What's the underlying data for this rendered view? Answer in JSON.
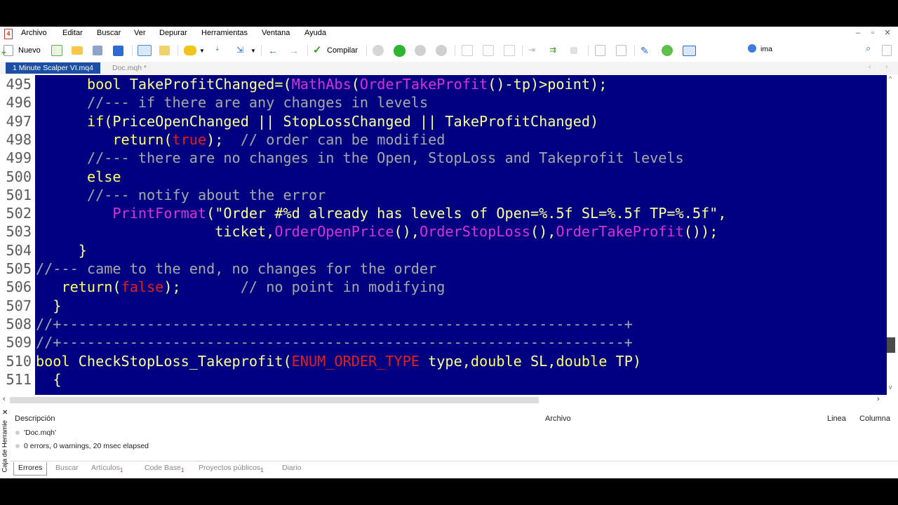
{
  "menu": [
    "Archivo",
    "Editar",
    "Buscar",
    "Ver",
    "Depurar",
    "Herramientas",
    "Ventana",
    "Ayuda"
  ],
  "app_icon": "4",
  "window_controls": [
    "–",
    "▫",
    "✕"
  ],
  "toolbar": {
    "new_label": "Nuevo",
    "compile_label": "Compilar"
  },
  "search": {
    "value": "ima"
  },
  "tabs": [
    {
      "label": "1 Minute Scalper VI.mq4"
    },
    {
      "label": "Doc.mqh *"
    }
  ],
  "code_lines": [
    {
      "num": "495",
      "indent": "      ",
      "tokens": [
        [
          "kw",
          "bool "
        ],
        [
          "id",
          "TakeProfitChanged=("
        ],
        [
          "fn",
          "MathAbs"
        ],
        [
          "id",
          "("
        ],
        [
          "fn",
          "OrderTakeProfit"
        ],
        [
          "id",
          "()-tp)>point);"
        ]
      ]
    },
    {
      "num": "496",
      "indent": "      ",
      "tokens": [
        [
          "cm",
          "//--- if there are any changes in levels"
        ]
      ]
    },
    {
      "num": "497",
      "indent": "      ",
      "tokens": [
        [
          "kw",
          "if"
        ],
        [
          "id",
          "(PriceOpenChanged || StopLossChanged || TakeProfitChanged)"
        ]
      ]
    },
    {
      "num": "498",
      "indent": "         ",
      "tokens": [
        [
          "kw",
          "return"
        ],
        [
          "id",
          "("
        ],
        [
          "red",
          "true"
        ],
        [
          "id",
          ");  "
        ],
        [
          "cm",
          "// order can be modified"
        ]
      ]
    },
    {
      "num": "499",
      "indent": "      ",
      "tokens": [
        [
          "cm",
          "//--- there are no changes in the Open, StopLoss and Takeprofit levels"
        ]
      ]
    },
    {
      "num": "500",
      "indent": "      ",
      "tokens": [
        [
          "kw",
          "else"
        ]
      ]
    },
    {
      "num": "501",
      "indent": "      ",
      "tokens": [
        [
          "cm",
          "//--- notify about the error"
        ]
      ]
    },
    {
      "num": "502",
      "indent": "         ",
      "tokens": [
        [
          "fn",
          "PrintFormat"
        ],
        [
          "st",
          "(\"Order #%d already has levels of Open=%.5f SL=%.5f TP=%.5f\","
        ]
      ]
    },
    {
      "num": "503",
      "indent": "                     ",
      "tokens": [
        [
          "id",
          "ticket,"
        ],
        [
          "fn",
          "OrderOpenPrice"
        ],
        [
          "id",
          "(),"
        ],
        [
          "fn",
          "OrderStopLoss"
        ],
        [
          "id",
          "(),"
        ],
        [
          "fn",
          "OrderTakeProfit"
        ],
        [
          "id",
          "());"
        ]
      ]
    },
    {
      "num": "504",
      "indent": "     ",
      "tokens": [
        [
          "id",
          "}"
        ]
      ]
    },
    {
      "num": "505",
      "indent": "",
      "tokens": [
        [
          "cm",
          "//--- came to the end, no changes for the order"
        ]
      ]
    },
    {
      "num": "506",
      "indent": "   ",
      "tokens": [
        [
          "kw",
          "return"
        ],
        [
          "id",
          "("
        ],
        [
          "red",
          "false"
        ],
        [
          "id",
          ");       "
        ],
        [
          "cm",
          "// no point in modifying"
        ]
      ]
    },
    {
      "num": "507",
      "indent": "  ",
      "tokens": [
        [
          "id",
          "}"
        ]
      ]
    },
    {
      "num": "508",
      "indent": "",
      "tokens": [
        [
          "cm",
          "//+------------------------------------------------------------------+"
        ]
      ]
    },
    {
      "num": "509",
      "indent": "",
      "tokens": [
        [
          "cm",
          "//+------------------------------------------------------------------+"
        ]
      ]
    },
    {
      "num": "510",
      "indent": "",
      "tokens": [
        [
          "kw",
          "bool "
        ],
        [
          "id",
          "CheckStopLoss_Takeprofit("
        ],
        [
          "red",
          "ENUM_ORDER_TYPE"
        ],
        [
          "id",
          " type,"
        ],
        [
          "kw",
          "double"
        ],
        [
          "id",
          " SL,"
        ],
        [
          "kw",
          "double"
        ],
        [
          "id",
          " TP)"
        ]
      ]
    },
    {
      "num": "511",
      "indent": "  ",
      "tokens": [
        [
          "id",
          "{"
        ]
      ]
    }
  ],
  "panel": {
    "headers": {
      "description": "Descripción",
      "file": "Archivo",
      "line": "Linea",
      "column": "Columna"
    },
    "rows": [
      "'Doc.mqh'",
      "0 errors, 0 warnings, 20 msec elapsed"
    ],
    "sidebar_label": "Caja de Herramie",
    "tabs": [
      {
        "label": "Errores",
        "badge": ""
      },
      {
        "label": "Buscar",
        "badge": ""
      },
      {
        "label": "Artículos",
        "badge": "1"
      },
      {
        "label": "Code Base",
        "badge": "1"
      },
      {
        "label": "Proyectos públicos",
        "badge": "1"
      },
      {
        "label": "Diario",
        "badge": ""
      }
    ]
  },
  "colors": {
    "editor_bg": "#000080",
    "tab_active": "#1b4fa6",
    "keyword": "#ffff66",
    "function": "#d633d6",
    "comment": "#a8a8a8",
    "constant": "#e02020"
  }
}
